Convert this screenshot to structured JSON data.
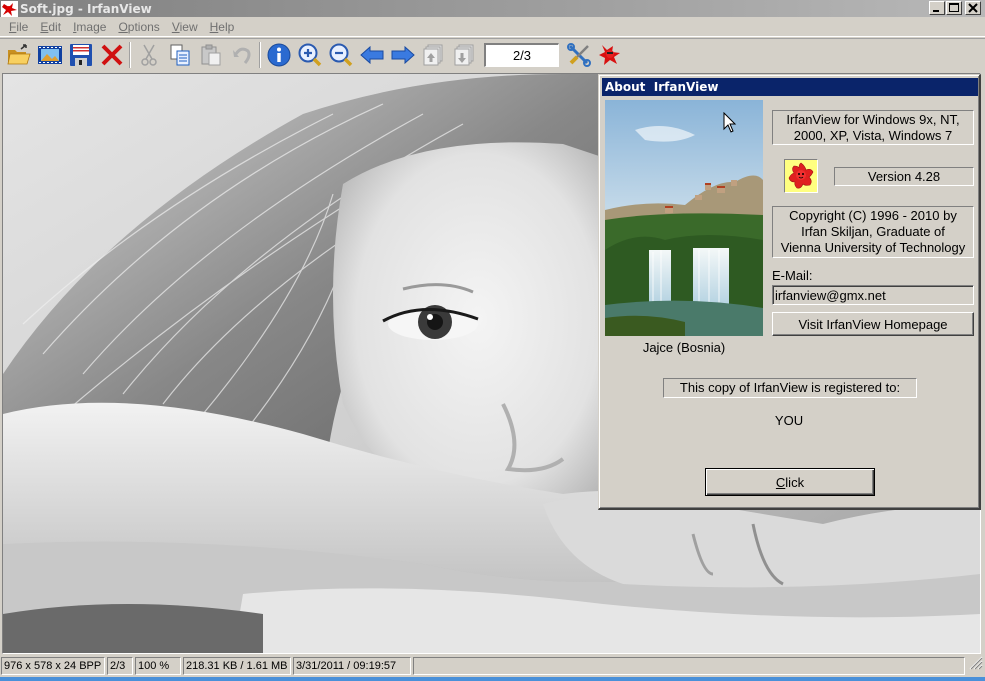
{
  "window": {
    "title": "Soft.jpg - IrfanView",
    "controls": {
      "minimize": "_",
      "maximize": "□",
      "close": "✕"
    }
  },
  "menu": [
    {
      "label": "File",
      "accel": "F",
      "rest": "ile"
    },
    {
      "label": "Edit",
      "accel": "E",
      "rest": "dit"
    },
    {
      "label": "Image",
      "accel": "I",
      "rest": "mage"
    },
    {
      "label": "Options",
      "accel": "O",
      "rest": "ptions"
    },
    {
      "label": "View",
      "accel": "V",
      "rest": "iew"
    },
    {
      "label": "Help",
      "accel": "H",
      "rest": "elp"
    }
  ],
  "toolbar": {
    "buttons": [
      {
        "icon": "open-folder-icon",
        "enabled": true
      },
      {
        "icon": "slideshow-icon",
        "enabled": true
      },
      {
        "icon": "save-icon",
        "enabled": true
      },
      {
        "icon": "delete-icon",
        "enabled": true
      },
      {
        "icon": "cut-icon",
        "enabled": false
      },
      {
        "icon": "copy-icon",
        "enabled": true
      },
      {
        "icon": "paste-icon",
        "enabled": false
      },
      {
        "icon": "undo-icon",
        "enabled": false
      },
      {
        "icon": "info-icon",
        "enabled": true
      },
      {
        "icon": "zoom-in-icon",
        "enabled": true
      },
      {
        "icon": "zoom-out-icon",
        "enabled": true
      },
      {
        "icon": "previous-arrow-icon",
        "enabled": true
      },
      {
        "icon": "next-arrow-icon",
        "enabled": true
      },
      {
        "icon": "first-page-icon",
        "enabled": false
      },
      {
        "icon": "last-page-icon",
        "enabled": false
      },
      {
        "icon": "settings-tools-icon",
        "enabled": true
      },
      {
        "icon": "irfanview-logo-icon",
        "enabled": true
      }
    ],
    "page_indicator": "2/3"
  },
  "status_bar": {
    "dimensions": "976 x 578 x 24 BPP",
    "page": "2/3",
    "zoom": "100 %",
    "size": "218.31 KB / 1.61 MB",
    "datetime": "3/31/2011 / 09:19:57",
    "extra": ""
  },
  "about_dialog": {
    "title": "About  IrfanView",
    "photo_caption": "Jajce (Bosnia)",
    "platforms": "IrfanView for Windows 9x, NT, 2000, XP, Vista, Windows 7",
    "platforms_line1": "IrfanView for Windows 9x, NT,",
    "platforms_line2": "2000, XP, Vista, Windows 7",
    "version": "Version 4.28",
    "copyright_line1": "Copyright (C) 1996 - 2010 by",
    "copyright_line2": "Irfan Skiljan, Graduate of",
    "copyright_line3": "Vienna University of Technology",
    "email_label": "E-Mail:",
    "email_value": "irfanview@gmx.net",
    "homepage_button": "Visit IrfanView Homepage",
    "registered_label": "This copy of IrfanView is registered to:",
    "registered_user": "YOU",
    "click_button_accel": "C",
    "click_button_rest": "lick",
    "click_button": "Click"
  },
  "colors": {
    "dialog_title_bg": "#0a246a",
    "face": "#d4d0c8",
    "inactive_title": "#808080"
  }
}
